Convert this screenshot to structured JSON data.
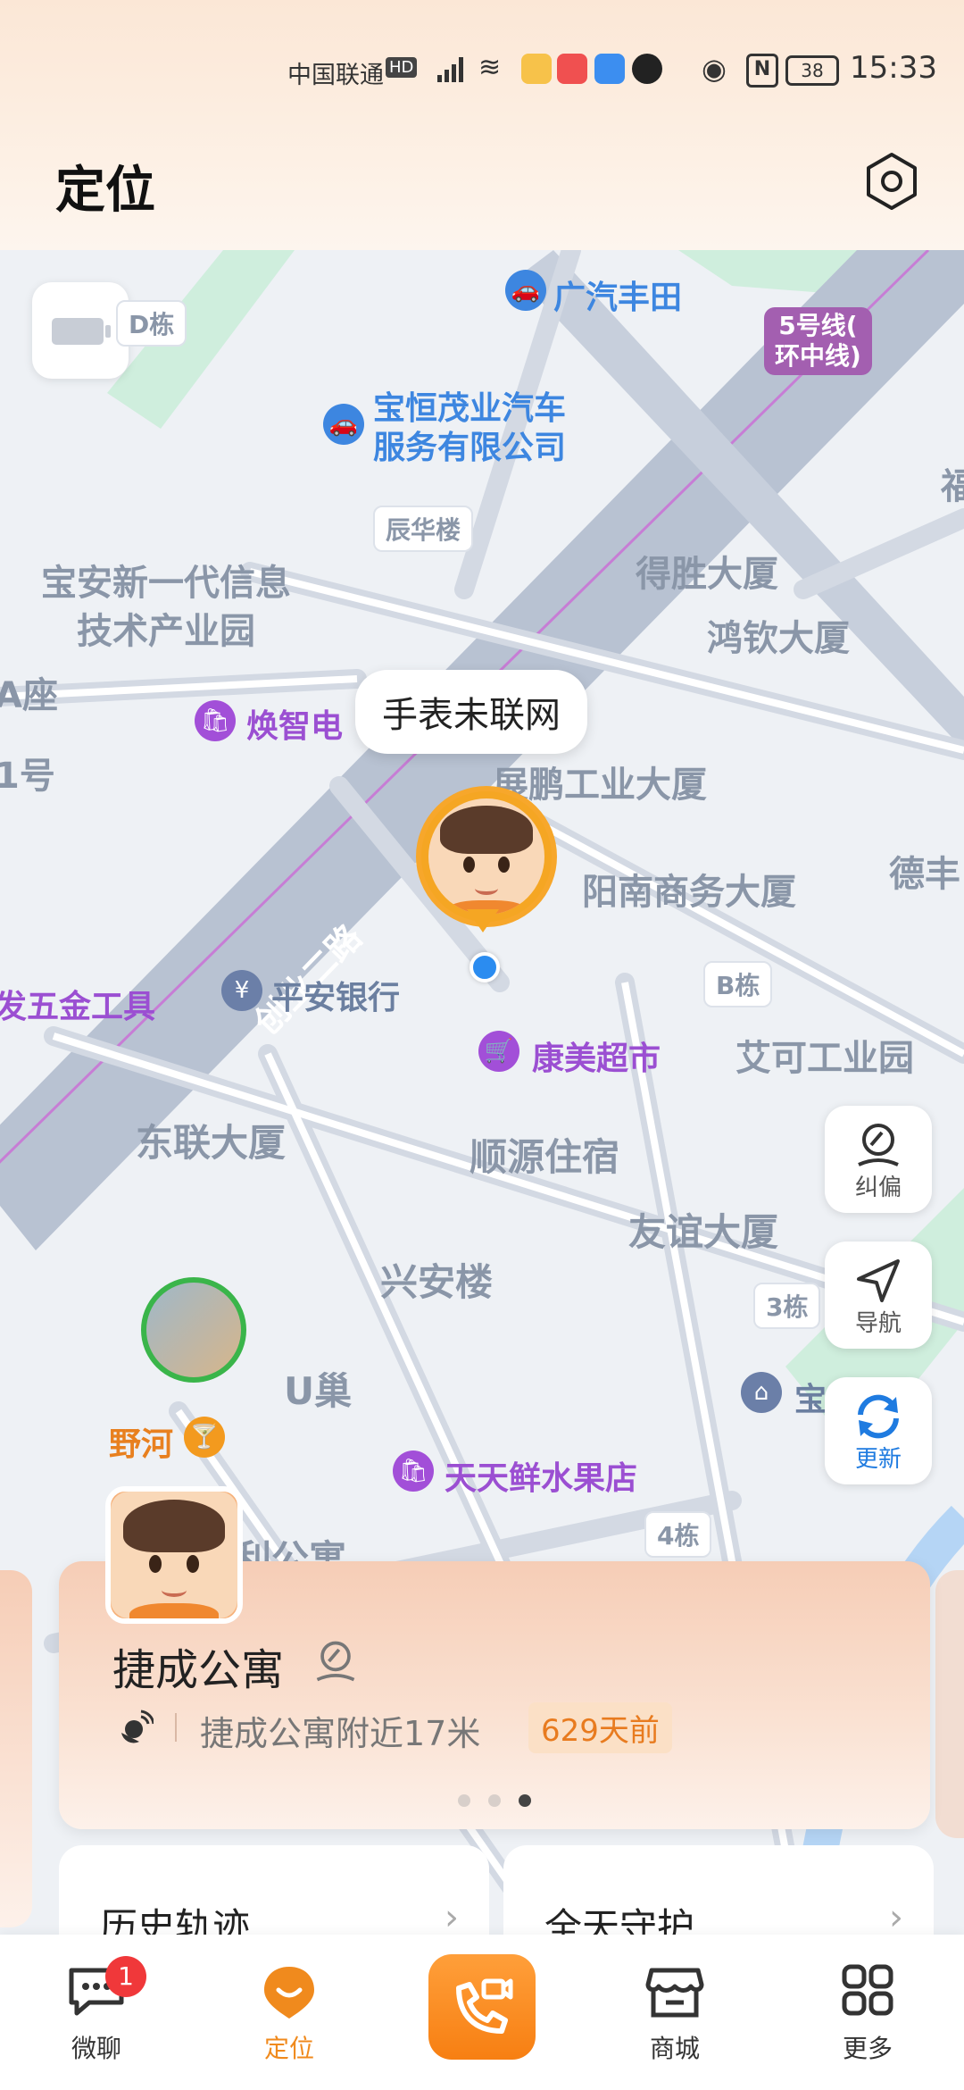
{
  "status_bar": {
    "carrier": "中国联通",
    "hd": "HD",
    "battery": "38",
    "nfc": "N",
    "time": "15:33"
  },
  "header": {
    "title": "定位"
  },
  "map": {
    "bubble": "手表未联网",
    "pois": {
      "gac_toyota": "广汽丰田",
      "baoheng": "宝恒茂业汽车\n服务有限公司",
      "metro": "5号线(\n环中线)",
      "d_building": "D栋",
      "chenhua": "辰华楼",
      "baoan_park": "宝安新一代信息\n技术产业园",
      "desheng": "得胜大厦",
      "hongqin": "鸿钦大厦",
      "a_zuo": "A座",
      "no1": "1号",
      "huanzhi": "焕智电",
      "chuangye_rd": "创业二路",
      "zhanpeng": "展鹏工业大厦",
      "yangnan": "阳南商务大厦",
      "defeng": "德丰",
      "pingan_bank": "平安银行",
      "hardware": "发五金工具",
      "b_building": "B栋",
      "kangmei": "康美超市",
      "aike": "艾可工业园",
      "donglian": "东联大厦",
      "shunyuan": "顺源住宿",
      "youyi": "友谊大厦",
      "xingan": "兴安楼",
      "b3": "3栋",
      "u_chao": "U巢",
      "yehe": "野河",
      "tiantian": "天天鲜水果店",
      "b4": "4栋",
      "li_apt": "利公寓",
      "bao": "宝",
      "fu": "福"
    },
    "buttons": {
      "correct": "纠偏",
      "navigate": "导航",
      "refresh": "更新"
    }
  },
  "location_card": {
    "place": "捷成公寓",
    "nearby": "捷成公寓附近17米",
    "ago": "629天前"
  },
  "quick_cards": {
    "history": "历史轨迹",
    "guard": "全天守护"
  },
  "nav": {
    "chat": "微聊",
    "chat_badge": "1",
    "locate": "定位",
    "mall": "商城",
    "more": "更多"
  },
  "colors": {
    "accent": "#f08a1d",
    "map_road": "#b8c2d2",
    "map_bg": "#eef1f5"
  }
}
